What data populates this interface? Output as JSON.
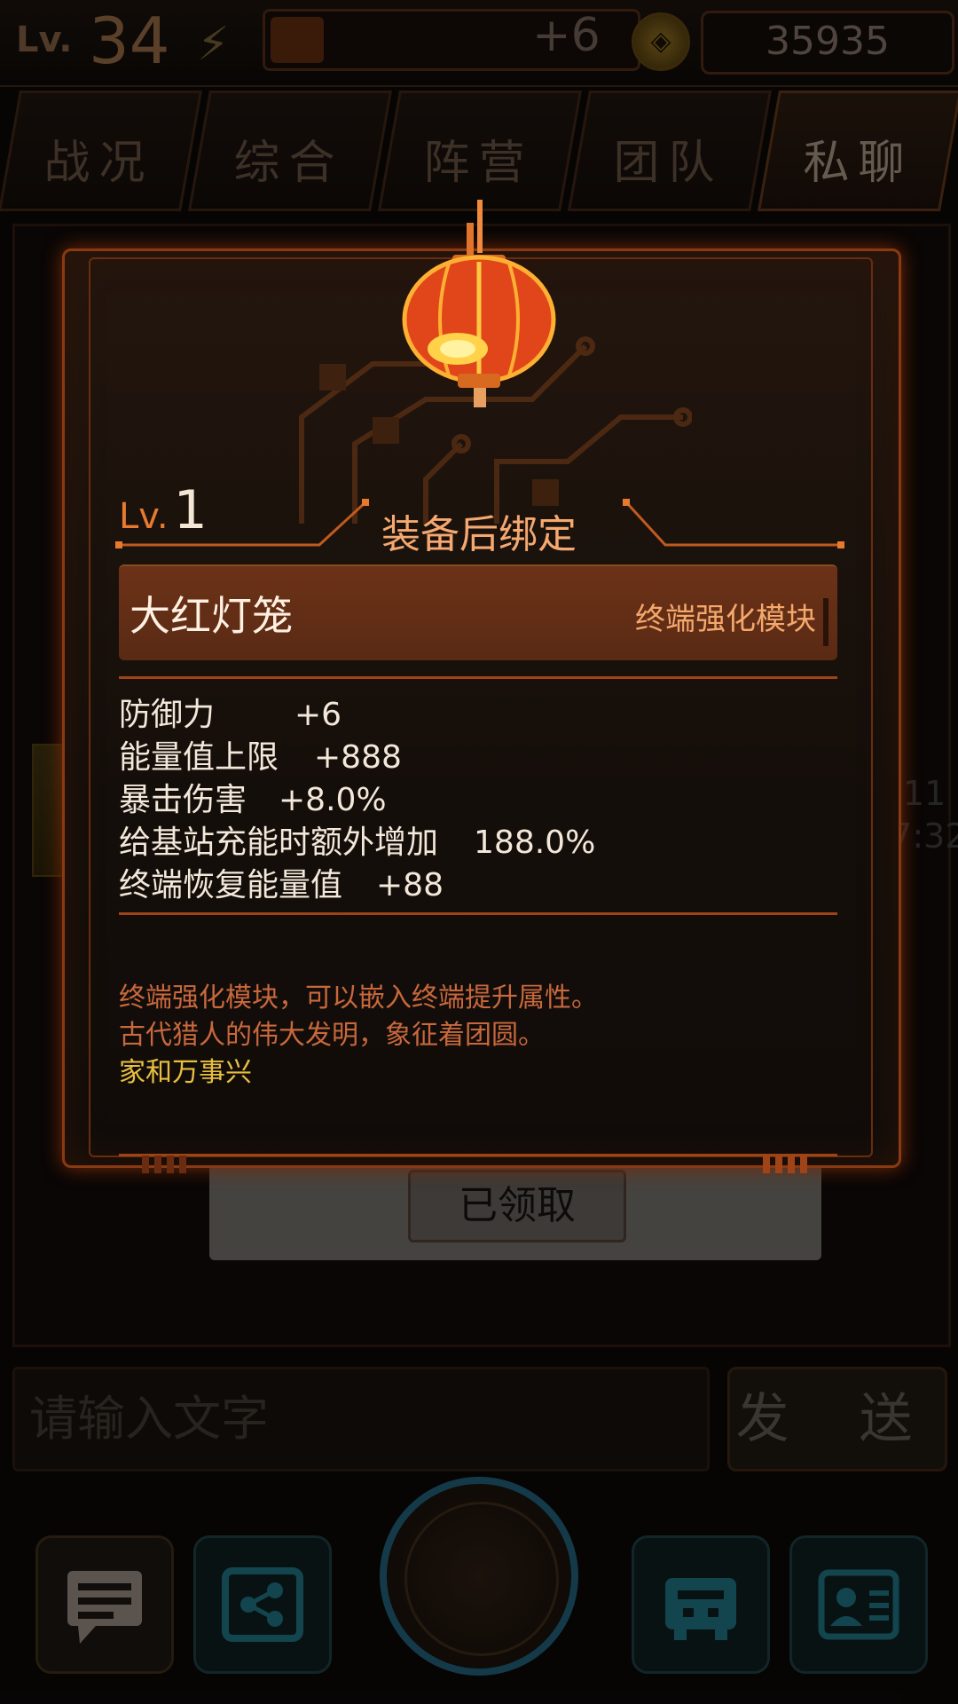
{
  "player": {
    "level_label": "Lv.",
    "level": "34",
    "energy_plus": "+6",
    "money": "35935"
  },
  "tabs": [
    {
      "label": "战况"
    },
    {
      "label": "综合"
    },
    {
      "label": "阵营"
    },
    {
      "label": "团队"
    },
    {
      "label": "私聊"
    }
  ],
  "background_chat": {
    "time_line1": "2-11",
    "time_line2": "07:32",
    "claimed_button": "已领取"
  },
  "input": {
    "placeholder": "请输入文字",
    "send_label": "发 送"
  },
  "item_detail": {
    "level_label": "Lv.",
    "level": "1",
    "bind_text": "装备后绑定",
    "name": "大红灯笼",
    "type": "终端强化模块",
    "stats": [
      {
        "key": "防御力",
        "value": "+6"
      },
      {
        "key": "能量值上限",
        "value": "+888"
      },
      {
        "key": "暴击伤害",
        "value": "+8.0%"
      },
      {
        "key": "给基站充能时额外增加",
        "value": "188.0%"
      },
      {
        "key": "终端恢复能量值",
        "value": "+88"
      }
    ],
    "description": [
      "终端强化模块，可以嵌入终端提升属性。",
      "古代猎人的伟大发明，象征着团圆。",
      "家和万事兴"
    ]
  },
  "dock": {
    "icons": [
      "chat-icon",
      "share-icon",
      "globe-icon",
      "terminal-icon",
      "profile-icon"
    ]
  },
  "colors": {
    "accent_orange": "#e87a30",
    "frame_orange": "#a04418",
    "gold_text": "#e8c040",
    "teal_dock": "#1f5a70"
  }
}
